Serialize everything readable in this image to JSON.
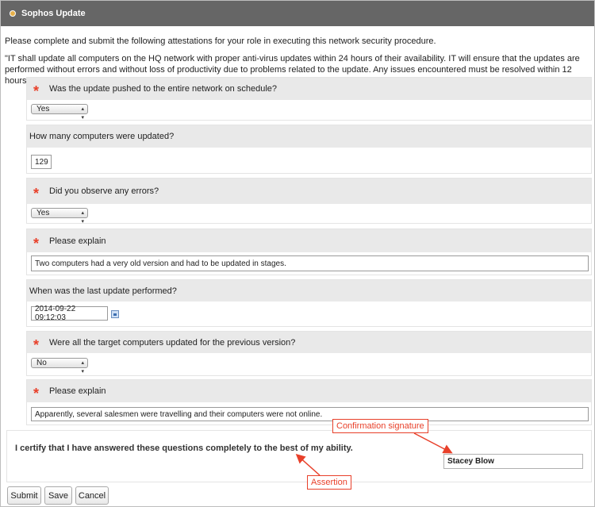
{
  "window": {
    "title": "Sophos Update"
  },
  "intro": "Please complete and submit the following attestations for your role in executing this network security procedure.",
  "quote": "\"IT shall update all computers on the HQ network with proper anti-virus updates within 24 hours of their availability. IT will ensure that the updates are performed without errors and without loss of productivity due to problems related to the update. Any issues encountered must be resolved within 12 hours.\"",
  "questions": [
    {
      "label": "Was the update pushed to the entire network on schedule?",
      "required": true,
      "value": "Yes"
    },
    {
      "label": "How many computers were updated?",
      "required": false,
      "value": "129"
    },
    {
      "label": "Did you observe any errors?",
      "required": true,
      "value": "Yes"
    },
    {
      "label": "Please explain",
      "required": true,
      "value": "Two computers had a very old version and had to be updated in stages."
    },
    {
      "label": "When was the last update performed?",
      "required": false,
      "value": "2014-09-22 09:12:03"
    },
    {
      "label": "Were all the target computers updated for the previous version?",
      "required": true,
      "value": "No"
    },
    {
      "label": "Please explain",
      "required": true,
      "value": "Apparently, several salesmen were travelling and their computers were not online."
    }
  ],
  "required_marker": "*",
  "certification": {
    "text": "I certify that I have answered these questions completely to the best of my ability.",
    "signature": "Stacey Blow"
  },
  "buttons": {
    "submit": "Submit",
    "save": "Save",
    "cancel": "Cancel"
  },
  "callouts": {
    "signature": "Confirmation signature",
    "assertion": "Assertion"
  },
  "colors": {
    "titlebar": "#666666",
    "question_header": "#e9e9e9",
    "required": "#e8402a",
    "callout": "#e8402a"
  }
}
